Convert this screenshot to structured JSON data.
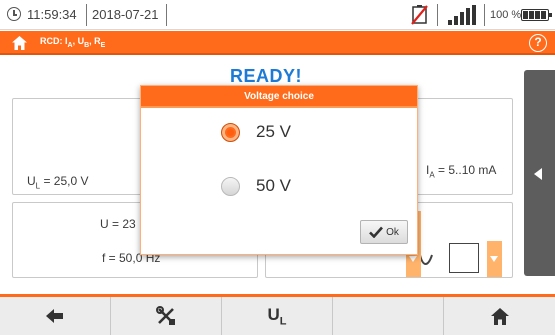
{
  "status_bar": {
    "time": "11:59:34",
    "date": "2018-07-21",
    "battery_percent": "100 %",
    "icons": [
      "clock-icon",
      "battery-warning-icon",
      "signal-icon",
      "battery-icon",
      "plug-icon"
    ]
  },
  "title_bar": {
    "title_main": "RCD: I",
    "title_sub_a": "A",
    "title_sep1": ", U",
    "title_sub_b": "B",
    "title_sep2": ", R",
    "title_sub_e": "E",
    "accent_color": "#ff6b1a",
    "help_glyph": "?"
  },
  "background": {
    "ready_text": "READY!",
    "ul_prefix": "U",
    "ul_sub": "L",
    "ul_value": " = 25,0 V",
    "ia_prefix": "I",
    "ia_sub": "A",
    "ia_value": " = 5..10 mA",
    "u_value": "U = 23",
    "f_value": "f = 50,0 Hz"
  },
  "modal": {
    "title": "Voltage choice",
    "options": [
      {
        "label": "25 V",
        "selected": true
      },
      {
        "label": "50 V",
        "selected": false
      }
    ],
    "ok_label": "Ok"
  },
  "toolbar": {
    "buttons": [
      "back-arrow-icon",
      "settings-tools-icon",
      "ul-button",
      "empty",
      "home-icon"
    ],
    "ul_main": "U",
    "ul_sub": "L"
  }
}
